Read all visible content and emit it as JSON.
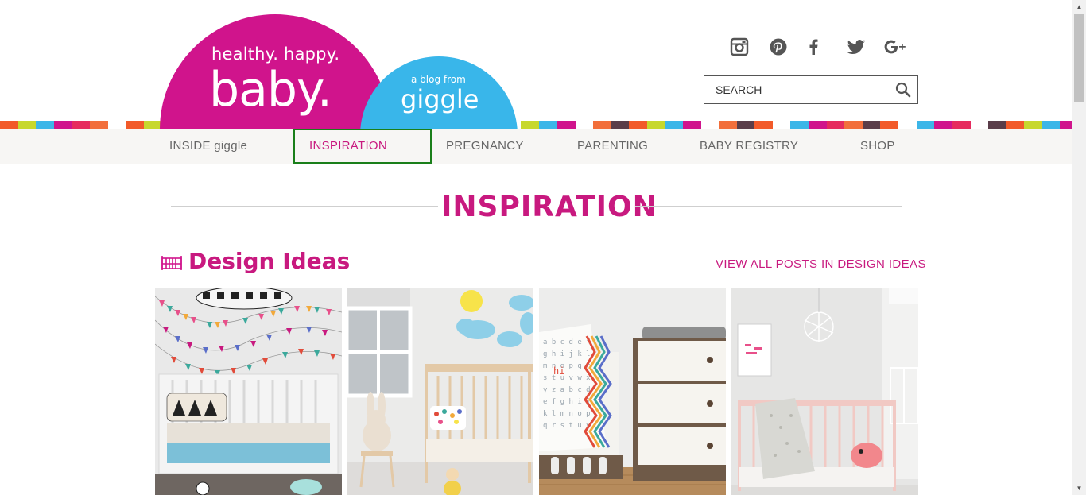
{
  "logo": {
    "tagline": "healthy. happy.",
    "name": "baby.",
    "blog_prefix": "a blog from",
    "brand": "giggle"
  },
  "social": {
    "icons": [
      "instagram-icon",
      "pinterest-icon",
      "facebook-icon",
      "twitter-icon",
      "google-plus-icon"
    ]
  },
  "search": {
    "placeholder": "SEARCH"
  },
  "nav": {
    "items": [
      {
        "label": "INSIDE giggle"
      },
      {
        "label": "INSPIRATION"
      },
      {
        "label": "PREGNANCY"
      },
      {
        "label": "PARENTING"
      },
      {
        "label": "BABY REGISTRY"
      },
      {
        "label": "SHOP"
      }
    ],
    "active": "INSPIRATION"
  },
  "page": {
    "title": "INSPIRATION"
  },
  "category": {
    "title": "Design Ideas",
    "view_all": "VIEW ALL POSTS IN DESIGN IDEAS",
    "icon": "crib-icon"
  },
  "colors": {
    "brand_pink": "#c8197f",
    "logo_pink": "#d0148c",
    "logo_blue": "#39b6ea",
    "active_border": "#1a7f1a",
    "stripe_colors": [
      "#f25a29",
      "#c7d82d",
      "#3cb6e8",
      "#d0148c",
      "#e62b5e",
      "#f26f3b",
      "#5a3d49"
    ]
  }
}
